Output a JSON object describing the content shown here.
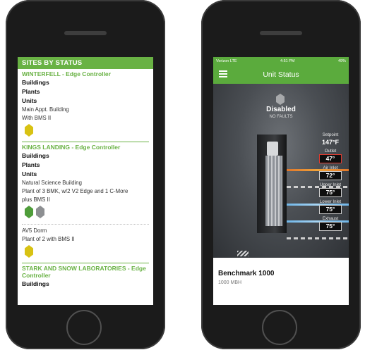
{
  "left_phone": {
    "header": "SITES BY STATUS",
    "sites": [
      {
        "title": "WINTERFELL - Edge Controller",
        "rows": [
          "Buildings",
          "Plants",
          "Units"
        ],
        "notes": [
          "Main Appt. Building",
          "With BMS II"
        ],
        "hex_colors": [
          "#d8c213"
        ]
      },
      {
        "title": "KINGS LANDING - Edge Controller",
        "rows": [
          "Buildings",
          "Plants",
          "Units"
        ],
        "notes": [
          "Natural Science Building",
          "Plant of 3 BMK, w/2 V2 Edge and 1 C-More",
          "plus BMS II"
        ],
        "hex_colors": [
          "#4f9d3a",
          "#8d8f92"
        ],
        "sub_notes": [
          "AV5 Dorm",
          "Plant of 2 with BMS II"
        ],
        "sub_hex_colors": [
          "#d8c213"
        ]
      },
      {
        "title": "STARK AND SNOW LABORATORIES - Edge Controller",
        "rows": [
          "Buildings"
        ]
      }
    ]
  },
  "right_phone": {
    "statusbar": {
      "carrier": "Verizon  LTE",
      "time": "4:51 PM",
      "battery": "49%"
    },
    "nav_title": "Unit Status",
    "status": {
      "main": "Disabled",
      "sub": "NO FAULTS"
    },
    "readouts": {
      "setpoint_label": "Setpoint",
      "setpoint_value": "147°F",
      "outlet_label": "Outlet",
      "outlet_value": "47°",
      "air_inlet_label": "Air Inlet",
      "air_inlet_value": "72°",
      "upper_inlet_label": "Upper Inlet",
      "upper_inlet_value": "75°",
      "lower_inlet_label": "Lower Inlet",
      "lower_inlet_value": "75°",
      "exhaust_label": "Exhaust",
      "exhaust_value": "75°"
    },
    "card": {
      "title": "Benchmark 1000",
      "subtitle": "1000 MBH"
    }
  },
  "colors": {
    "brand_green": "#69b244",
    "alert_red": "#e23a2e"
  }
}
